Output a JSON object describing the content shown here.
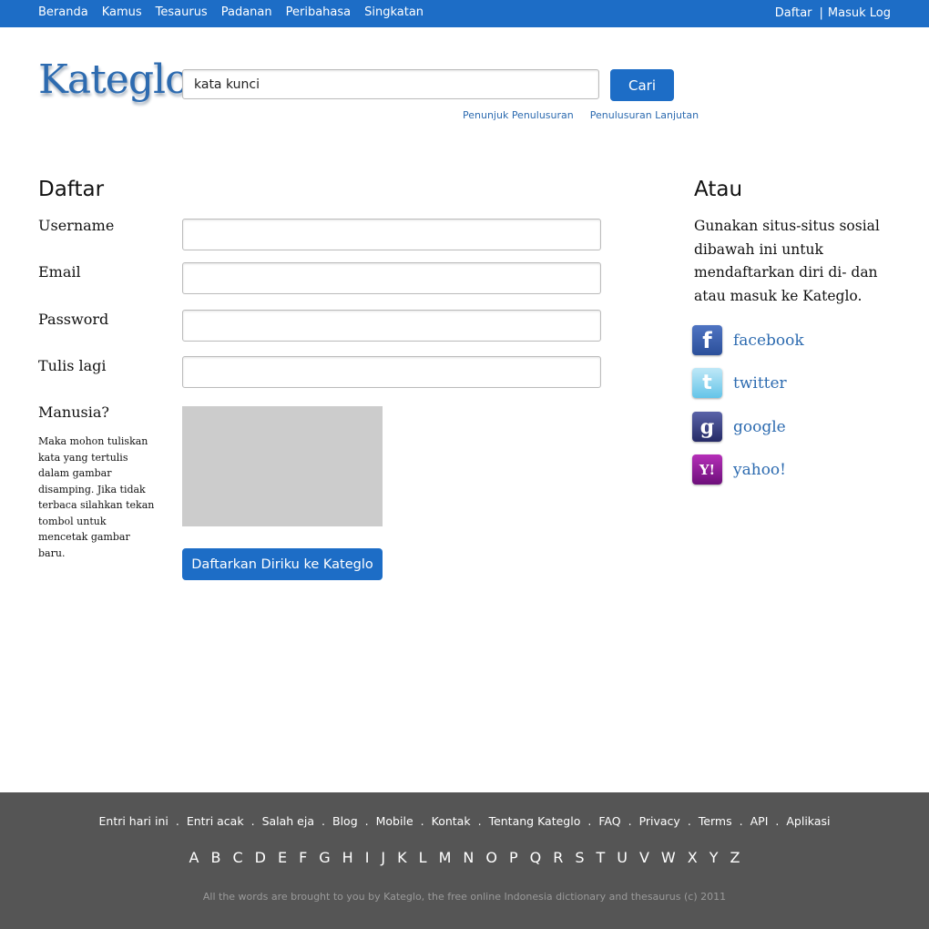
{
  "top_nav": {
    "items": [
      "Beranda",
      "Kamus",
      "Tesaurus",
      "Padanan",
      "Peribahasa",
      "Singkatan"
    ],
    "register": "Daftar",
    "separator": "|",
    "login": "Masuk Log"
  },
  "header": {
    "logo": "Kateglo",
    "search_value": "kata kunci",
    "search_button": "Cari",
    "links": [
      "Penunjuk Penulusuran",
      "Penulusuran Lanjutan"
    ]
  },
  "form": {
    "title": "Daftar",
    "username_label": "Username",
    "email_label": "Email",
    "password_label": "Password",
    "repeat_label": "Tulis lagi",
    "captcha_label": "Manusia?",
    "captcha_help": "Maka mohon tuliskan kata yang tertulis dalam gambar disamping. Jika tidak terbaca silahkan tekan tombol untuk mencetak gambar baru.",
    "submit": "Daftarkan Diriku ke Kateglo"
  },
  "social": {
    "title": "Atau",
    "description": "Gunakan situs-situs sosial dibawah ini untuk mendaftarkan diri di- dan atau masuk ke Kateglo.",
    "items": [
      {
        "label": "facebook",
        "icon": "facebook-icon",
        "glyph": "f"
      },
      {
        "label": "twitter",
        "icon": "twitter-icon",
        "glyph": "t"
      },
      {
        "label": "google",
        "icon": "google-icon",
        "glyph": "g"
      },
      {
        "label": "yahoo!",
        "icon": "yahoo-icon",
        "glyph": "Y!"
      }
    ]
  },
  "footer": {
    "links": [
      "Entri hari ini",
      "Entri acak",
      "Salah eja",
      "Blog",
      "Mobile",
      "Kontak",
      "Tentang Kateglo",
      "FAQ",
      "Privacy",
      "Terms",
      "API",
      "Aplikasi"
    ],
    "separator": ".",
    "alphabet": [
      "A",
      "B",
      "C",
      "D",
      "E",
      "F",
      "G",
      "H",
      "I",
      "J",
      "K",
      "L",
      "M",
      "N",
      "O",
      "P",
      "Q",
      "R",
      "S",
      "T",
      "U",
      "V",
      "W",
      "X",
      "Y",
      "Z"
    ],
    "copyright": "All the words are brought to you by Kateglo, the free online Indonesia dictionary and thesaurus (c) 2011"
  },
  "colors": {
    "brand_blue": "#1d6dc6",
    "link_blue": "#2d6bb0",
    "footer_bg": "#555555",
    "captcha_placeholder": "#cccccc"
  }
}
